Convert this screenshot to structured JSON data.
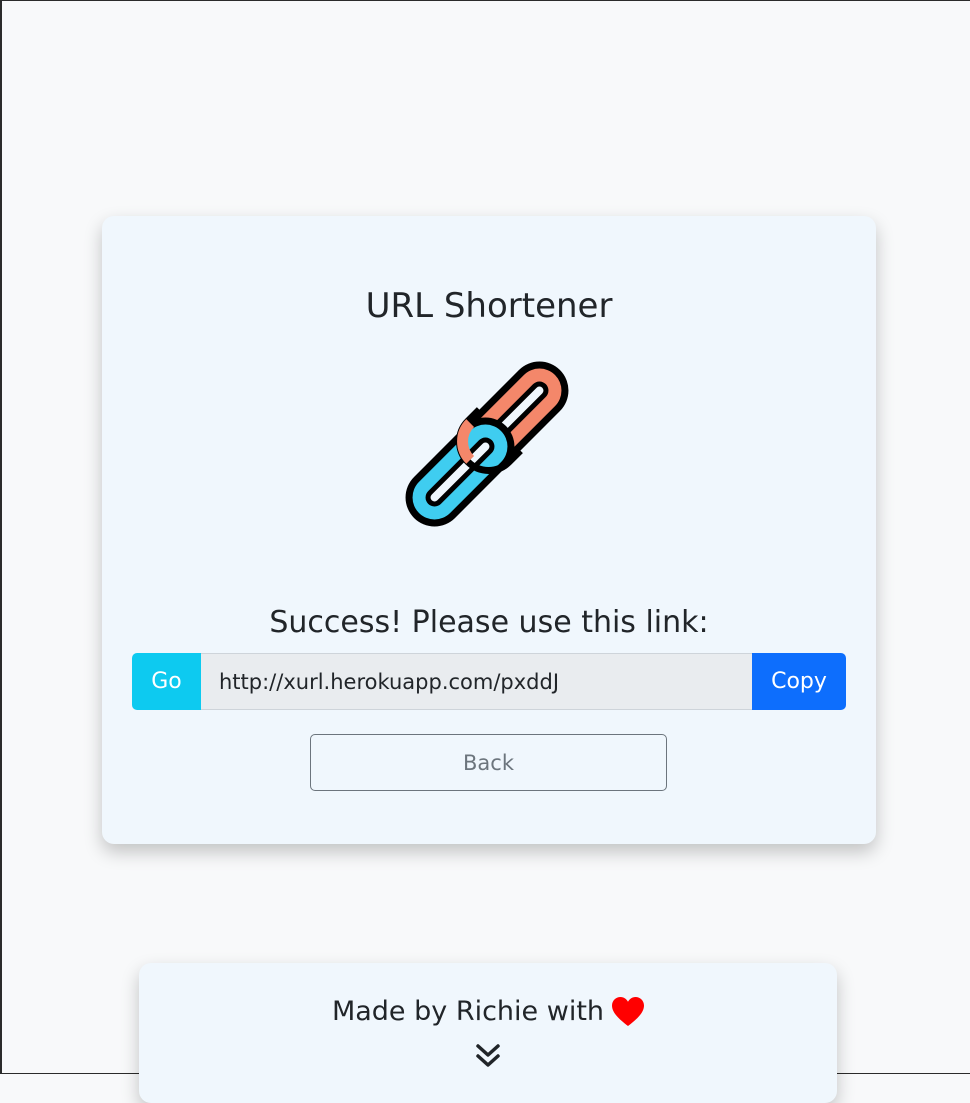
{
  "card": {
    "title": "URL Shortener",
    "logo_icon": "chain-link-icon",
    "success_message": "Success! Please use this link:",
    "short_link": "http://xurl.herokuapp.com/pxddJ",
    "go_label": "Go",
    "copy_label": "Copy",
    "back_label": "Back"
  },
  "footer": {
    "made_by": "Made by Richie with",
    "heart_icon": "heart-icon",
    "expand_icon": "chevrons-down-icon"
  },
  "colors": {
    "go_button": "#0dcaf0",
    "copy_button": "#0d6efd",
    "card_background": "#f0f7fd",
    "heart": "#ff0000",
    "chain_orange": "#f4876a",
    "chain_blue": "#3fcdf0"
  }
}
